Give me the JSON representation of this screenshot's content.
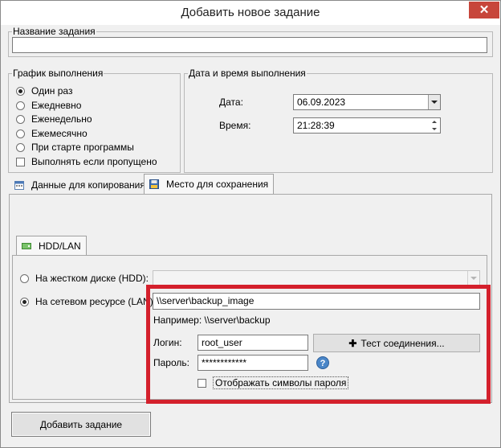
{
  "window": {
    "title": "Добавить новое задание"
  },
  "task_name": {
    "legend": "Название задания",
    "value": ""
  },
  "schedule": {
    "legend": "График выполнения",
    "options": [
      "Один раз",
      "Ежедневно",
      "Еженедельно",
      "Ежемесячно",
      "При старте программы"
    ],
    "selected_index": 0,
    "run_if_missed_label": "Выполнять если пропущено",
    "run_if_missed_checked": false
  },
  "datetime": {
    "legend": "Дата и время выполнения",
    "date_label": "Дата:",
    "date_value": "06.09.2023",
    "time_label": "Время:",
    "time_value": "21:28:39"
  },
  "tabs": {
    "items": [
      "Данные для копирования",
      "Место для сохранения"
    ],
    "active_index": 1,
    "inner_tab": "HDD/LAN"
  },
  "storage": {
    "hdd_label": "На жестком диске (HDD):",
    "hdd_value": "",
    "lan_label": "На сетевом ресурсе (LAN):",
    "lan_selected": true,
    "lan_path": "\\\\server\\backup_image",
    "example_text": "Например: \\\\server\\backup",
    "login_label": "Логин:",
    "login_value": "root_user",
    "password_label": "Пароль:",
    "password_value": "************",
    "test_connection_label": "Тест соединения...",
    "show_password_label": "Отображать символы пароля",
    "show_password_checked": false
  },
  "footer": {
    "add_task_label": "Добавить задание"
  },
  "colors": {
    "highlight": "#d4202c",
    "close": "#c7463b"
  },
  "icons": [
    "close-icon",
    "calendar-icon",
    "save-icon",
    "hdd-icon",
    "plus-icon",
    "help-icon"
  ]
}
